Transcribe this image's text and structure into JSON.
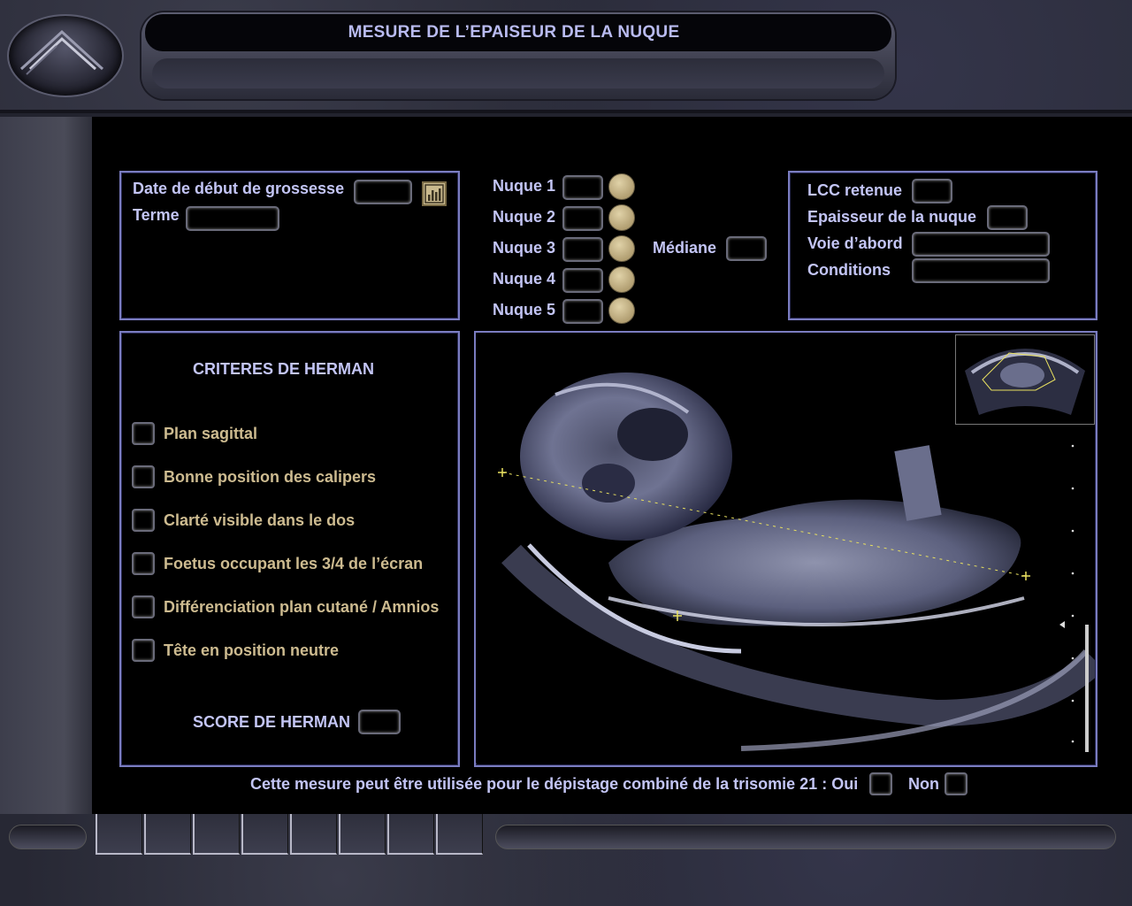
{
  "header": {
    "title": "MESURE DE L’EPAISEUR DE LA NUQUE"
  },
  "pregnancy": {
    "start_date_label": "Date de début de grossesse",
    "start_date_value": "",
    "term_label": "Terme",
    "term_value": ""
  },
  "nuque": {
    "items": [
      {
        "label": "Nuque 1",
        "value": ""
      },
      {
        "label": "Nuque 2",
        "value": ""
      },
      {
        "label": "Nuque 3",
        "value": ""
      },
      {
        "label": "Nuque 4",
        "value": ""
      },
      {
        "label": "Nuque 5",
        "value": ""
      }
    ],
    "mediane_label": "Médiane",
    "mediane_value": ""
  },
  "summary": {
    "lcc_label": "LCC retenue",
    "epaisseur_label": "Epaisseur de la nuque",
    "voie_label": "Voie d’abord",
    "conditions_label": "Conditions"
  },
  "herman": {
    "title": "CRITERES DE HERMAN",
    "criteria": [
      "Plan sagittal",
      "Bonne position des calipers",
      "Clarté visible dans le dos",
      "Foetus occupant les 3/4 de l’écran",
      "Différenciation plan cutané / Amnios",
      "Tête en position neutre"
    ],
    "score_label": "SCORE DE HERMAN",
    "score_value": ""
  },
  "footer": {
    "question": "Cette mesure peut être utilisée pour le dépistage combiné de la trisomie 21 : Oui",
    "non_label": "Non"
  },
  "colors": {
    "label": "#c3c5f5",
    "criteria": "#cdbb90",
    "panel_border": "#7a7cc0",
    "caliper": "#e8e060"
  },
  "icons": {
    "logo": "mountain-logo-icon",
    "chart": "bar-chart-icon"
  }
}
